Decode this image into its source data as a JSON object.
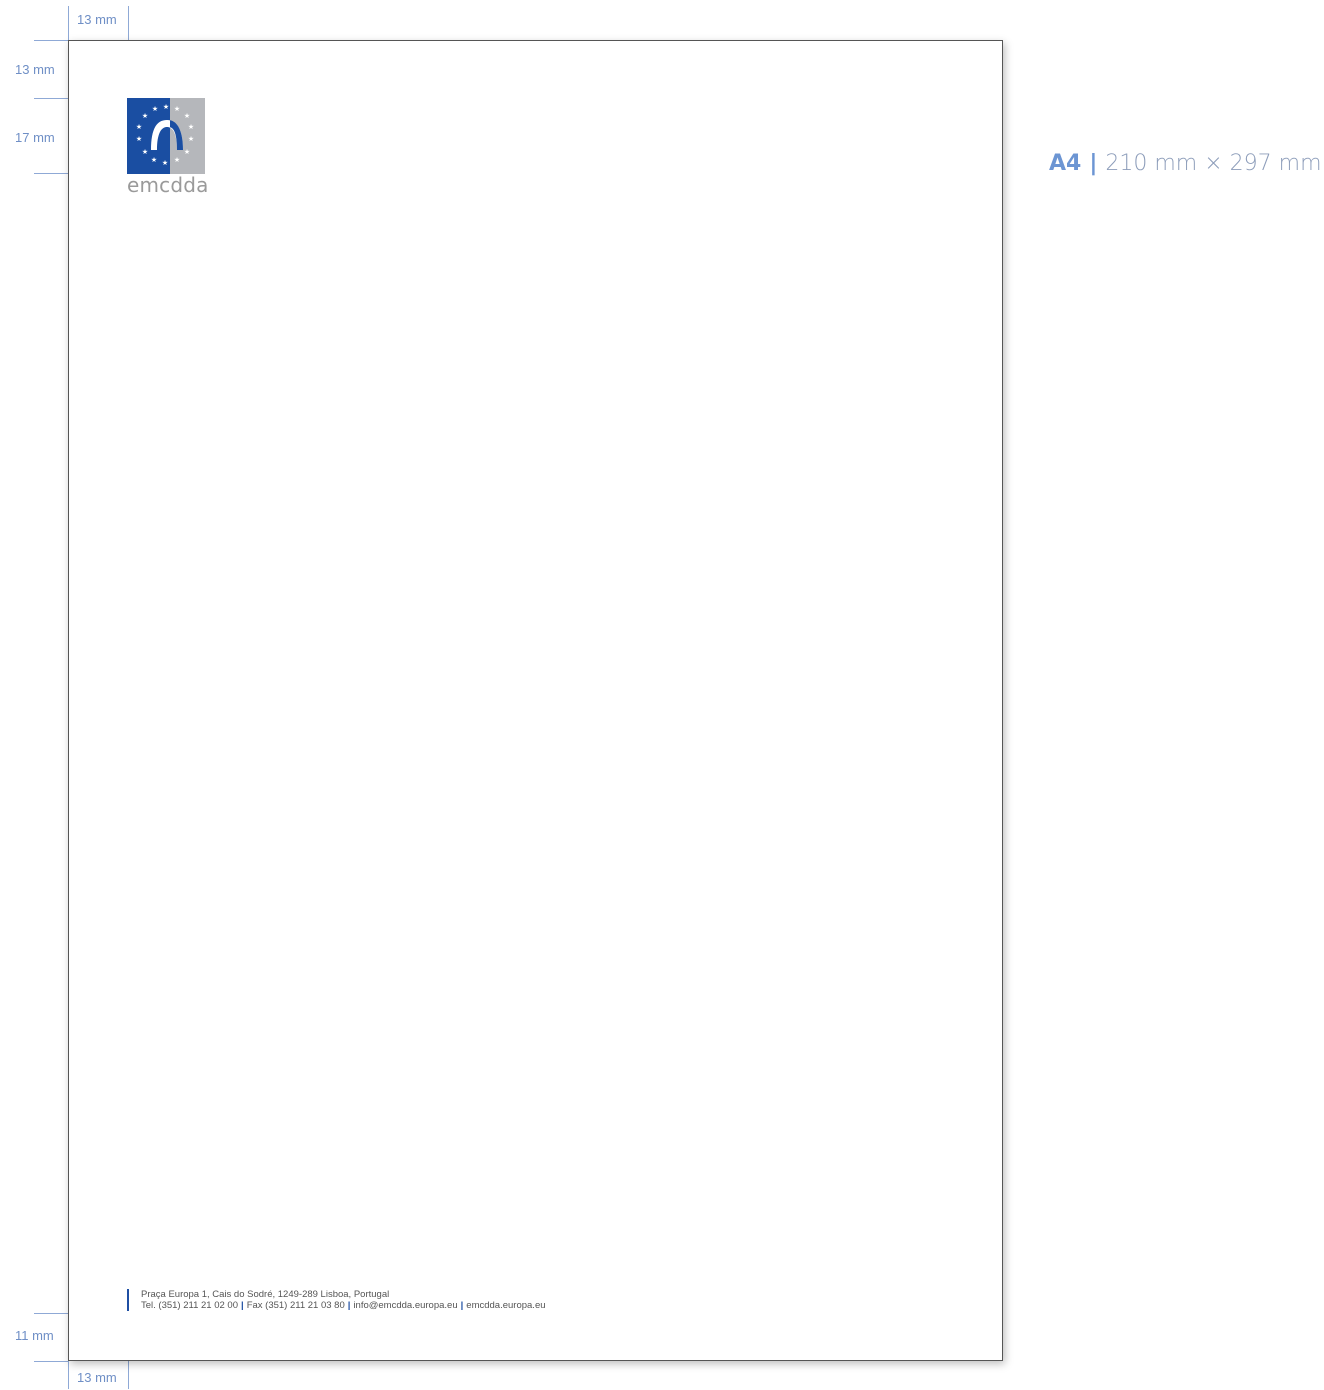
{
  "dimensions": {
    "left_margin_top": "13 mm",
    "top_margin": "13 mm",
    "logo_height": "17 mm",
    "bottom_margin": "11 mm",
    "left_margin_bottom": "13 mm"
  },
  "format": {
    "size_name": "A4",
    "size_dims": "210 mm × 297 mm"
  },
  "letterhead": {
    "logo": {
      "wordmark": "emcdda",
      "colors": {
        "blue": "#1a4ea2",
        "grey": "#b5b7bb"
      }
    },
    "footer": {
      "address": "Praça Europa 1, Cais do Sodré, 1249-289 Lisboa, Portugal",
      "tel": "Tel. (351) 211 21 02 00",
      "fax": "Fax (351) 211 21 03 80",
      "email": "info@emcdda.europa.eu",
      "web": "emcdda.europa.eu"
    }
  }
}
